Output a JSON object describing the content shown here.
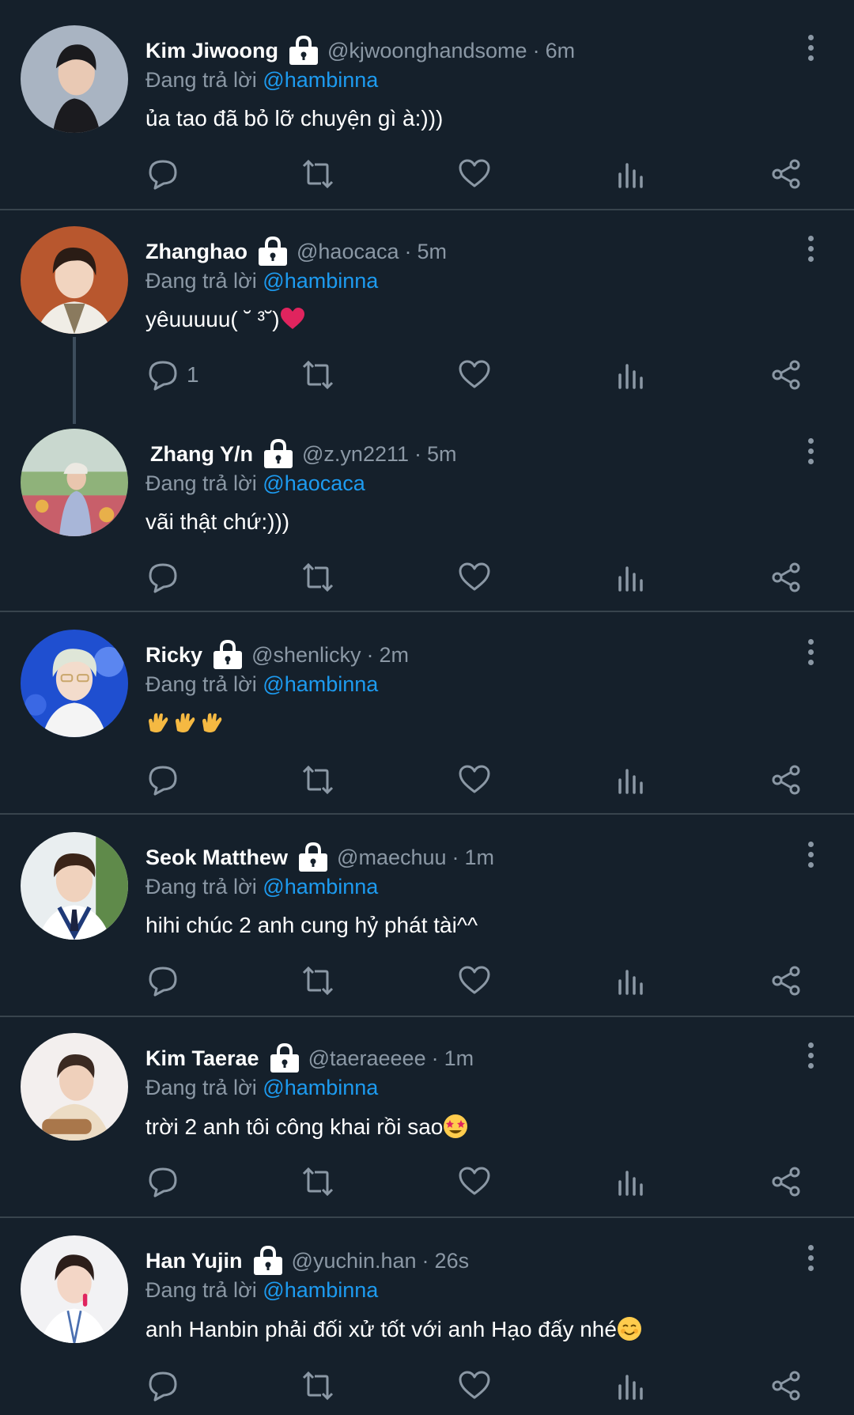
{
  "tweets": [
    {
      "name": "Kim Jiwoong",
      "handle": "@kjwoonghandsome",
      "time": "6m",
      "reply_prefix": "Đang trả lời",
      "reply_to": "@hambinna",
      "text": "ủa tao đã bỏ lỡ chuyện gì à:)))",
      "reply_count": ""
    },
    {
      "name": "Zhanghao",
      "handle": "@haocaca",
      "time": "5m",
      "reply_prefix": "Đang trả lời",
      "reply_to": "@hambinna",
      "text": "yêuuuuu( ˘ ³˘)",
      "reply_count": "1"
    },
    {
      "name": "Zhang Y/n",
      "handle": "@z.yn2211",
      "time": "5m",
      "reply_prefix": "Đang trả lời",
      "reply_to": "@haocaca",
      "text": "vãi thật chứ:)))",
      "reply_count": ""
    },
    {
      "name": "Ricky",
      "handle": "@shenlicky",
      "time": "2m",
      "reply_prefix": "Đang trả lời",
      "reply_to": "@hambinna",
      "text": "",
      "reply_count": ""
    },
    {
      "name": "Seok Matthew",
      "handle": "@maechuu",
      "time": "1m",
      "reply_prefix": "Đang trả lời",
      "reply_to": "@hambinna",
      "text": "hihi chúc 2 anh cung hỷ phát tài^^",
      "reply_count": ""
    },
    {
      "name": "Kim Taerae",
      "handle": "@taeraeeee",
      "time": "1m",
      "reply_prefix": "Đang trả lời",
      "reply_to": "@hambinna",
      "text": "trời 2 anh tôi công khai rồi sao",
      "reply_count": ""
    },
    {
      "name": "Han Yujin",
      "handle": "@yuchin.han",
      "time": "26s",
      "reply_prefix": "Đang trả lời",
      "reply_to": "@hambinna",
      "text": "anh Hanbin phải đối xử tốt với anh Hạo đấy nhé",
      "reply_count": ""
    }
  ],
  "separator": "·",
  "icons": {
    "reply": "reply-icon",
    "retweet": "retweet-icon",
    "like": "like-icon",
    "views": "views-icon",
    "share": "share-icon",
    "lock": "lock-icon",
    "more": "more-icon"
  },
  "colors": {
    "background": "#15202b",
    "divider": "#38444d",
    "muted": "#8b98a5",
    "mention": "#1d9bf0",
    "text": "#ffffff"
  }
}
